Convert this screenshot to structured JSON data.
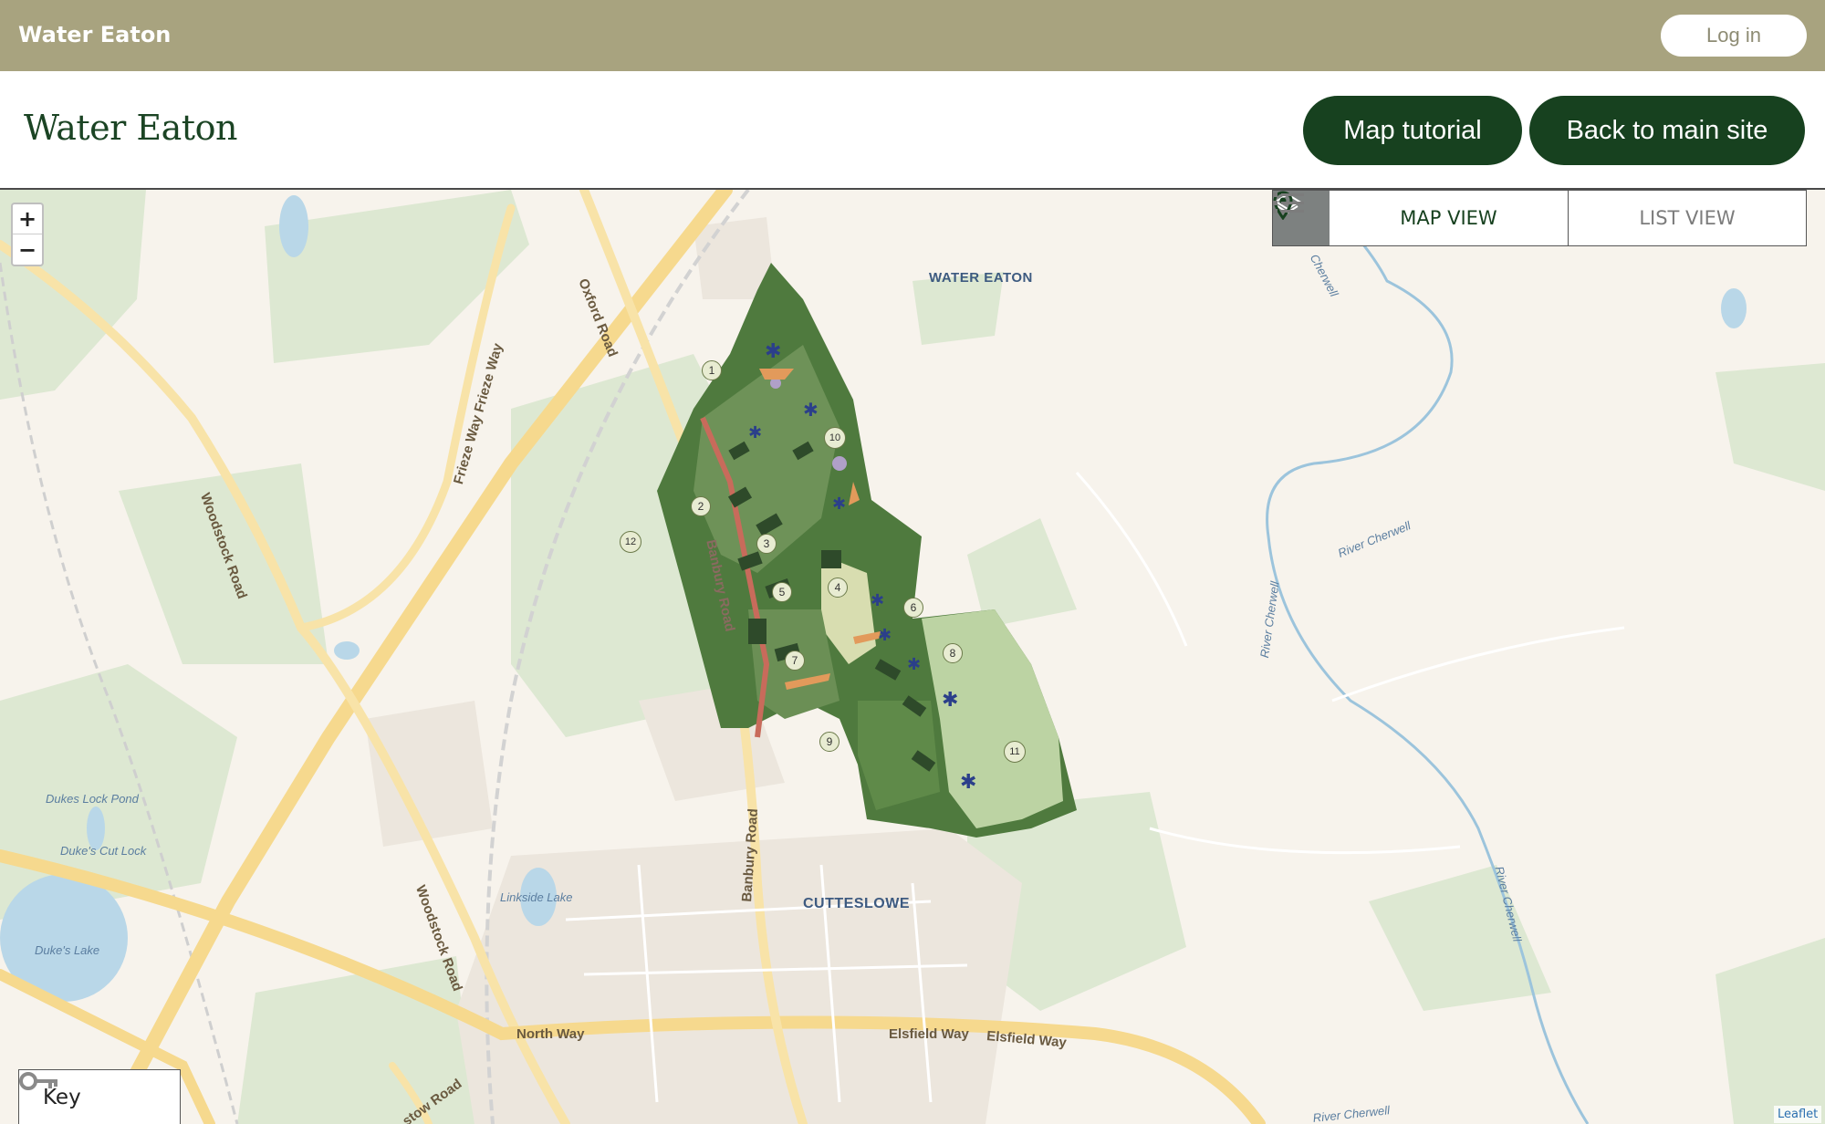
{
  "topbar": {
    "site_name": "Water Eaton",
    "login_label": "Log in"
  },
  "header": {
    "logo_text": "Water Eaton",
    "tutorial_label": "Map tutorial",
    "back_label": "Back to main site"
  },
  "map_controls": {
    "zoom_in": "+",
    "zoom_out": "−",
    "map_view_label": "MAP VIEW",
    "list_view_label": "LIST VIEW",
    "key_label": "Key",
    "attribution": "Leaflet"
  },
  "map_labels": {
    "water_eaton": "WATER EATON",
    "cutteslowe": "CUTTESLOWE",
    "oxford_road": "Oxford Road",
    "frieze_way": "Frieze Way Frieze Way",
    "woodstock_road_1": "Woodstock Road",
    "woodstock_road_2": "Woodstock Road",
    "banbury_road_1": "Banbury Road",
    "banbury_road_2": "Banbury Road",
    "north_way": "North Way",
    "elsfield_way_1": "Elsfield Way",
    "elsfield_way_2": "Elsfield Way",
    "stow_road": "stow Road",
    "dukes_lock_pond": "Dukes Lock Pond",
    "dukes_cut_lock": "Duke's Cut Lock",
    "dukes_lake": "Duke's Lake",
    "linkside_lake": "Linkside Lake",
    "river_cherwell_1": "River Cherwell",
    "river_cherwell_2": "River Cherwell",
    "river_cherwell_3": "River Cherwell",
    "river_cherwell_4": "River Cherwell",
    "river_cherwell_5": "Cherwell"
  },
  "site_markers": [
    "1",
    "2",
    "3",
    "4",
    "5",
    "6",
    "7",
    "8",
    "9",
    "10",
    "11",
    "12"
  ],
  "colors": {
    "topbar": "#a8a37f",
    "brand_green": "#17411f",
    "map_bg": "#f7f3ec",
    "park_green": "#d8e6cc",
    "road_yellow": "#f6d98e",
    "water": "#b9d7e8"
  },
  "icons": {
    "layers": "layers-icon",
    "map_view": "map-pin-icon",
    "list_view": "list-icon",
    "key": "key-icon"
  }
}
